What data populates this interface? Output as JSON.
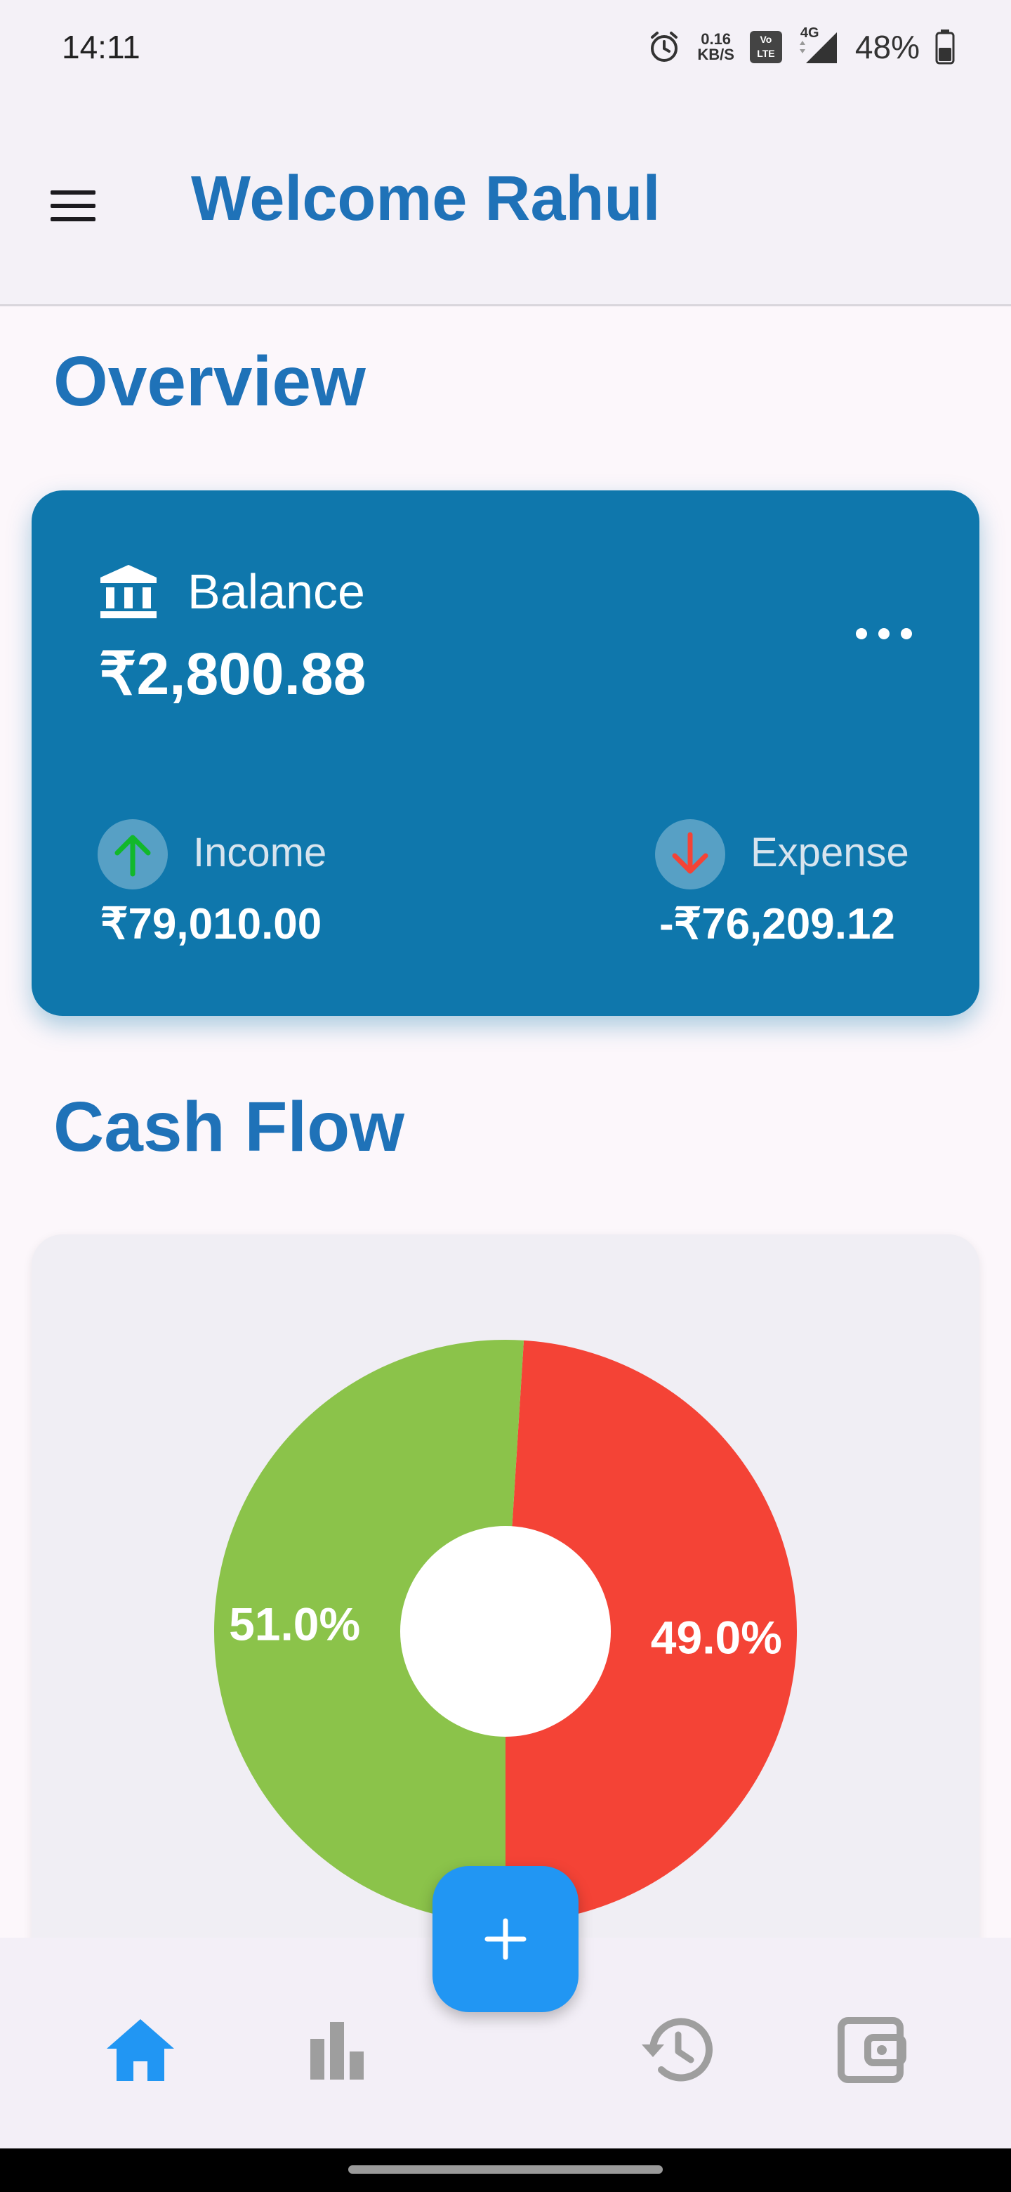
{
  "status_bar": {
    "time": "14:11",
    "net_speed_value": "0.16",
    "net_speed_unit": "KB/S",
    "volte_top": "Vo",
    "volte_bottom": "LTE",
    "network": "4G",
    "battery": "48%"
  },
  "app_bar": {
    "title": "Welcome Rahul"
  },
  "overview": {
    "title": "Overview",
    "balance_label": "Balance",
    "balance_value": "₹2,800.88",
    "income_label": "Income",
    "income_value": "₹79,010.00",
    "expense_label": "Expense",
    "expense_value": "-₹76,209.12"
  },
  "cash_flow": {
    "title": "Cash Flow"
  },
  "chart_data": {
    "type": "pie",
    "donut": true,
    "slices": [
      {
        "value": 51.0,
        "label": "51.0%",
        "color": "#8bc34a"
      },
      {
        "value": 49.0,
        "label": "49.0%",
        "color": "#f44336"
      }
    ]
  },
  "colors": {
    "primary": "#1f72b8",
    "card": "#0f77ac",
    "income": "#8bc34a",
    "expense": "#f44336",
    "fab": "#2196f3",
    "nav_active": "#2196f3",
    "nav_inactive": "#9e9e9e"
  },
  "bottom_nav": {
    "items": [
      {
        "icon": "home-icon",
        "active": true
      },
      {
        "icon": "bar-chart-icon",
        "active": false
      },
      {
        "icon": "history-icon",
        "active": false
      },
      {
        "icon": "wallet-icon",
        "active": false
      }
    ],
    "fab_icon": "plus-icon"
  }
}
